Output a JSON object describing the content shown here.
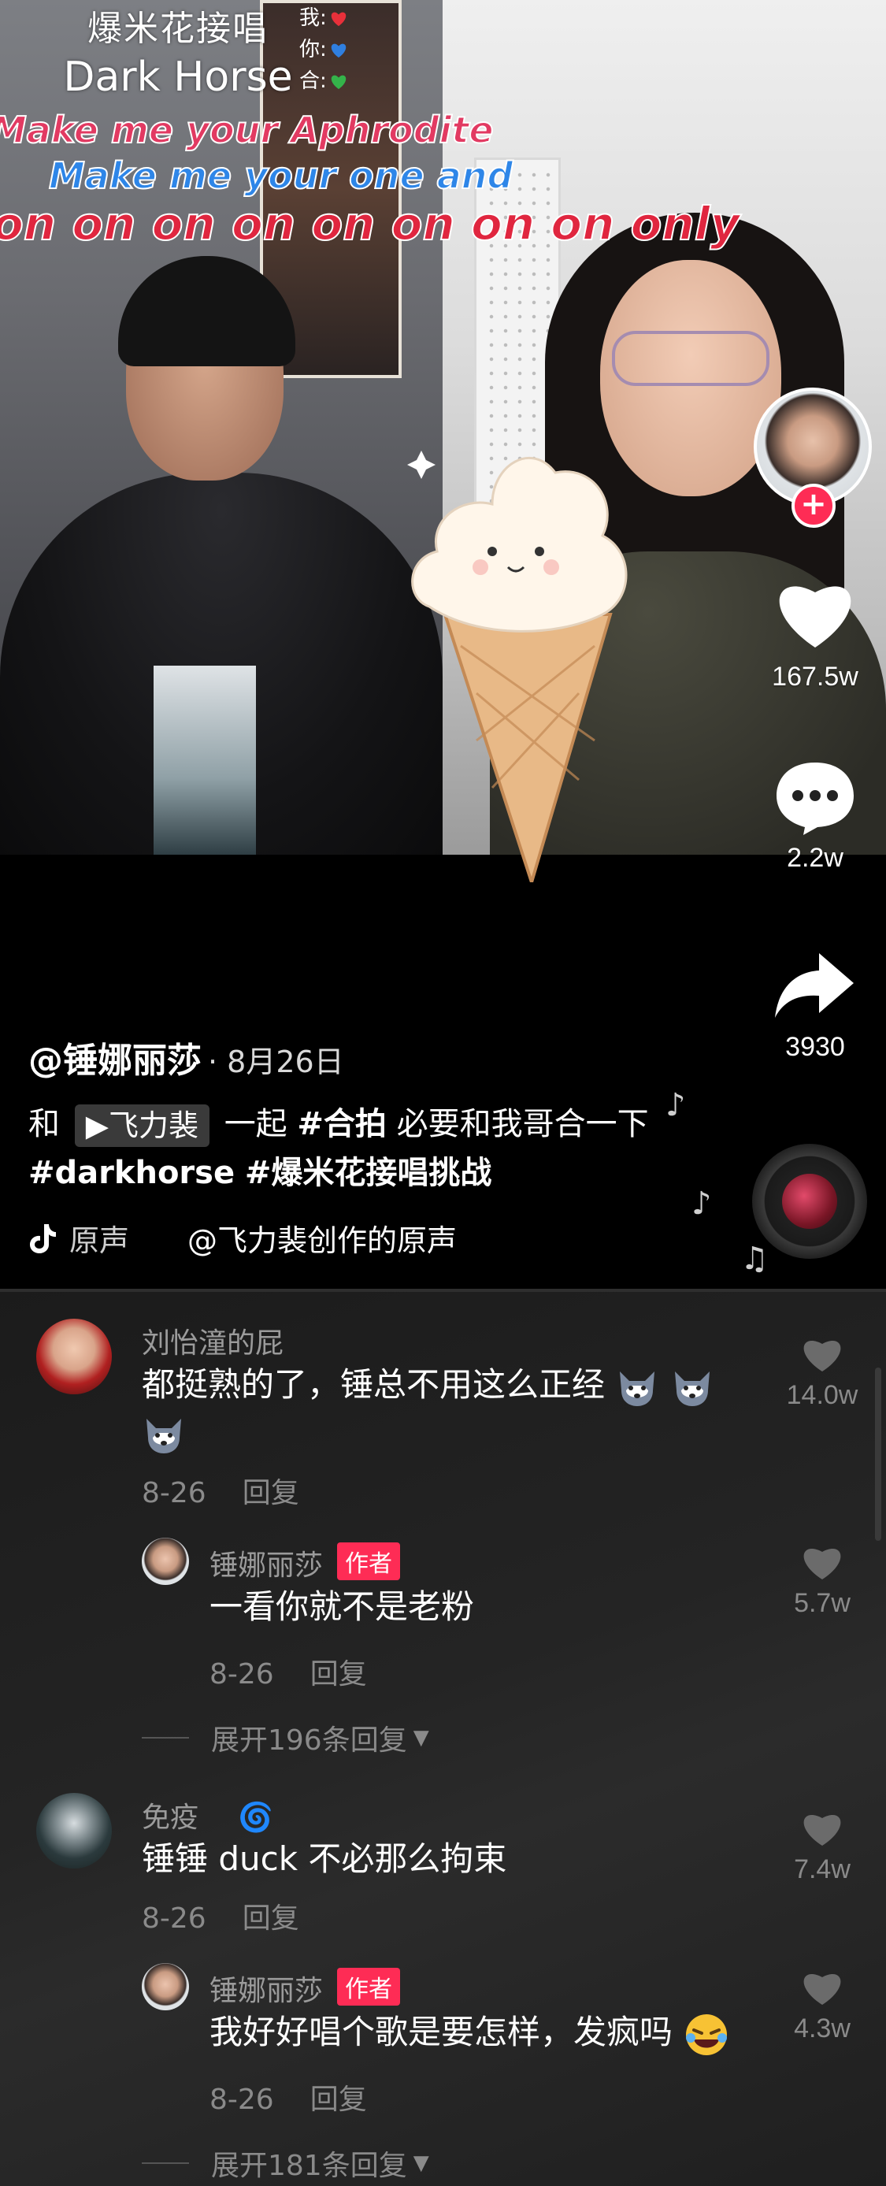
{
  "video": {
    "lyrics": {
      "title_cn": "爆米花接唱",
      "title_en": "Dark Horse",
      "roles": [
        "我:",
        "你:",
        "合:"
      ],
      "line1": "Make me your Aphrodite",
      "line2": "Make me your one and",
      "line3": "on on on on on on on on only"
    }
  },
  "rail": {
    "likes": "167.5w",
    "comments": "2.2w",
    "shares": "3930"
  },
  "caption": {
    "author": "@锤娜丽莎",
    "date": "· 8月26日",
    "desc_prefix": "和",
    "mention": "飞力裴",
    "desc_mid": "一起",
    "tag1": "#合拍",
    "desc_text": "必要和我哥合一下",
    "tag2": "#darkhorse",
    "tag3": "#爆米花接唱挑战",
    "music_a": "原声",
    "music_b": "@飞力裴创作的原声"
  },
  "comments": [
    {
      "name": "刘怡潼的屁",
      "text": "都挺熟的了，锤总不用这么正经",
      "date": "8-26",
      "reply": "回复",
      "likes": "14.0w"
    },
    {
      "name": "锤娜丽莎",
      "tag": "作者",
      "text": "一看你就不是老粉",
      "date": "8-26",
      "reply": "回复",
      "likes": "5.7w"
    },
    {
      "expand": "展开196条回复"
    },
    {
      "name": "免疫",
      "text": "锤锤 duck 不必那么拘束",
      "date": "8-26",
      "reply": "回复",
      "likes": "7.4w"
    },
    {
      "name": "锤娜丽莎",
      "tag": "作者",
      "text": "我好好唱个歌是要怎样，发疯吗",
      "date": "8-26",
      "reply": "回复",
      "likes": "4.3w"
    },
    {
      "expand": "展开181条回复"
    }
  ],
  "colors": {
    "accent": "#fe2c55",
    "lyric_red": "#e23a62",
    "lyric_blue": "#2e86e8"
  }
}
